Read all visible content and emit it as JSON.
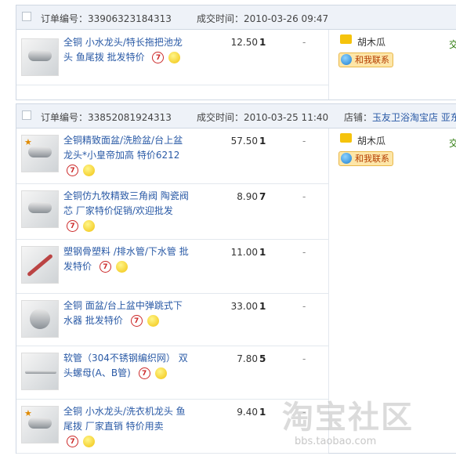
{
  "orders": [
    {
      "number_label": "订单编号：33906323184313",
      "time_label": "成交时间：2010-03-26 09:47",
      "seller": {
        "name": "胡木瓜",
        "contact_label": "和我联系"
      },
      "status": "交",
      "items": [
        {
          "title": "全铜 小水龙头/特长拖把池龙头 鱼尾拨 批发特价",
          "price": "12.50",
          "qty": "1",
          "dash": "-"
        }
      ]
    },
    {
      "number_label": "订单编号：33852081924313",
      "time_label": "成交时间：2010-03-25 11:40",
      "store_prefix": "店铺：",
      "store_name": "玉友卫浴淘宝店 亚东",
      "seller": {
        "name": "胡木瓜",
        "contact_label": "和我联系"
      },
      "status": "交",
      "items": [
        {
          "title": "全铜精致面盆/洗脸盆/台上盆龙头*小皇帝加高 特价6212",
          "price": "57.50",
          "qty": "1",
          "dash": "-"
        },
        {
          "title": "全铜仿九牧精致三角阀 陶瓷阀芯 厂家特价促销/欢迎批发",
          "price": "8.90",
          "qty": "7",
          "dash": "-"
        },
        {
          "title": "塑钢骨塑料 /排水管/下水管 批发特价",
          "price": "11.00",
          "qty": "1",
          "dash": "-"
        },
        {
          "title": "全铜 面盆/台上盆中弹跳式下水器 批发特价",
          "price": "33.00",
          "qty": "1",
          "dash": "-"
        },
        {
          "title": "软管（304不锈钢编织网） 双头螺母(A、B管)",
          "price": "7.80",
          "qty": "5",
          "dash": "-"
        },
        {
          "title": "全铜 小水龙头/洗衣机龙头 鱼尾拨 厂家直销 特价用卖",
          "price": "9.40",
          "qty": "1",
          "dash": "-"
        }
      ]
    }
  ],
  "icons": {
    "seven_day": "7",
    "bulb": "💡",
    "medal": "★"
  },
  "watermark": {
    "text": "淘宝社区",
    "url": "bbs.taobao.com"
  }
}
